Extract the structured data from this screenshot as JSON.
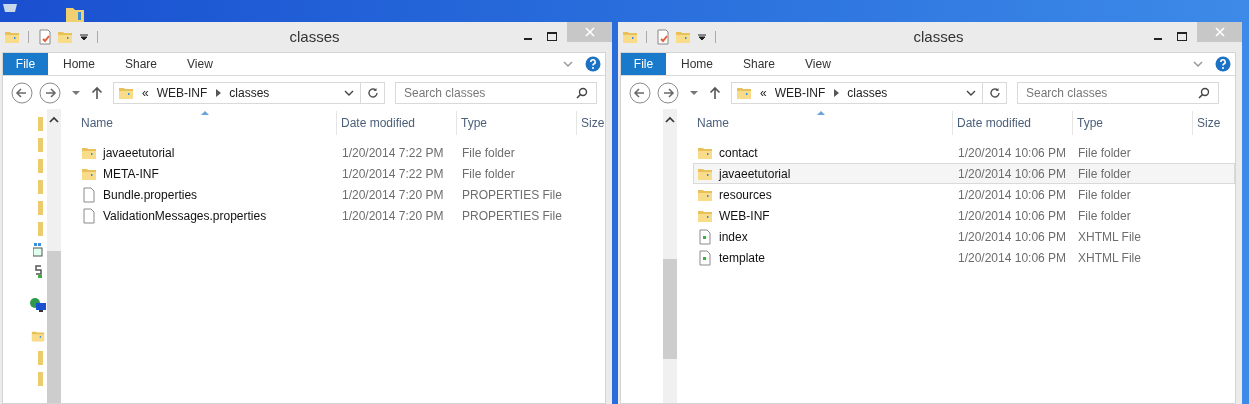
{
  "windows": [
    {
      "title": "classes",
      "ribbon": [
        {
          "label": "File",
          "kind": "file"
        },
        {
          "label": "Home",
          "kind": "tab"
        },
        {
          "label": "Share",
          "kind": "tab"
        },
        {
          "label": "View",
          "kind": "tab"
        }
      ],
      "address": {
        "overflow": "«",
        "crumbs": [
          "WEB-INF",
          "classes"
        ]
      },
      "search": {
        "placeholder": "Search classes"
      },
      "columns": [
        "Name",
        "Date modified",
        "Type",
        "Size"
      ],
      "rows": [
        {
          "name": "javaeetutorial",
          "date": "1/20/2014 7:22 PM",
          "type": "File folder",
          "kind": "folder",
          "hovered": false
        },
        {
          "name": "META-INF",
          "date": "1/20/2014 7:22 PM",
          "type": "File folder",
          "kind": "folder",
          "hovered": false
        },
        {
          "name": "Bundle.properties",
          "date": "1/20/2014 7:20 PM",
          "type": "PROPERTIES File",
          "kind": "file",
          "hovered": false
        },
        {
          "name": "ValidationMessages.properties",
          "date": "1/20/2014 7:20 PM",
          "type": "PROPERTIES File",
          "kind": "file",
          "hovered": false
        }
      ]
    },
    {
      "title": "classes",
      "ribbon": [
        {
          "label": "File",
          "kind": "file"
        },
        {
          "label": "Home",
          "kind": "tab"
        },
        {
          "label": "Share",
          "kind": "tab"
        },
        {
          "label": "View",
          "kind": "tab"
        }
      ],
      "address": {
        "overflow": "«",
        "crumbs": [
          "WEB-INF",
          "classes"
        ]
      },
      "search": {
        "placeholder": "Search classes"
      },
      "columns": [
        "Name",
        "Date modified",
        "Type",
        "Size"
      ],
      "rows": [
        {
          "name": "contact",
          "date": "1/20/2014 10:06 PM",
          "type": "File folder",
          "kind": "folder",
          "hovered": false
        },
        {
          "name": "javaeetutorial",
          "date": "1/20/2014 10:06 PM",
          "type": "File folder",
          "kind": "folder",
          "hovered": true
        },
        {
          "name": "resources",
          "date": "1/20/2014 10:06 PM",
          "type": "File folder",
          "kind": "folder",
          "hovered": false
        },
        {
          "name": "WEB-INF",
          "date": "1/20/2014 10:06 PM",
          "type": "File folder",
          "kind": "folder",
          "hovered": false
        },
        {
          "name": "index",
          "date": "1/20/2014 10:06 PM",
          "type": "XHTML File",
          "kind": "xhtml",
          "hovered": false
        },
        {
          "name": "template",
          "date": "1/20/2014 10:06 PM",
          "type": "XHTML File",
          "kind": "xhtml",
          "hovered": false
        }
      ]
    }
  ]
}
